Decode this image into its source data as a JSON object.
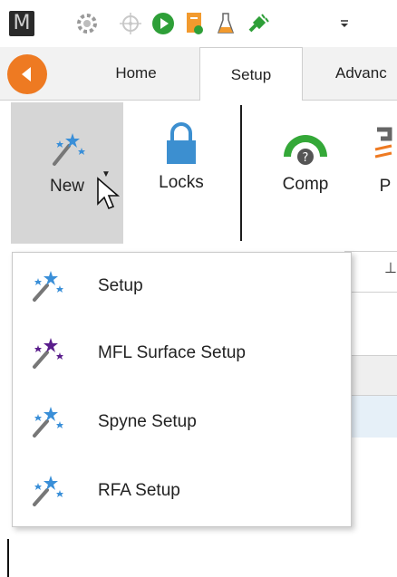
{
  "qat": {
    "app_logo": "M",
    "icons": [
      "settings-gear-icon",
      "target-icon",
      "play-icon",
      "document-icon",
      "flask-icon",
      "plug-icon",
      "customize-arrow-icon"
    ]
  },
  "tabs": {
    "back_icon": "back-arrow-icon",
    "items": [
      {
        "label": "Home"
      },
      {
        "label": "Setup"
      },
      {
        "label": "Advanc"
      }
    ],
    "active": "Setup"
  },
  "ribbon": {
    "new_label": "New",
    "locks_label": "Locks",
    "comp_label": "Comp",
    "p_label": "P"
  },
  "menu": {
    "items": [
      {
        "label": "Setup",
        "icon": "magic-wand-blue-icon"
      },
      {
        "label": "MFL Surface Setup",
        "icon": "magic-wand-purple-icon"
      },
      {
        "label": "Spyne Setup",
        "icon": "magic-wand-blue-icon"
      },
      {
        "label": "RFA Setup",
        "icon": "magic-wand-blue-icon"
      }
    ]
  },
  "colors": {
    "accent_orange": "#ee7a22",
    "lock_blue": "#3c8fd0",
    "gauge_green": "#34a838",
    "wand_blue": "#3a8fd8",
    "wand_purple": "#5a1e8c"
  }
}
